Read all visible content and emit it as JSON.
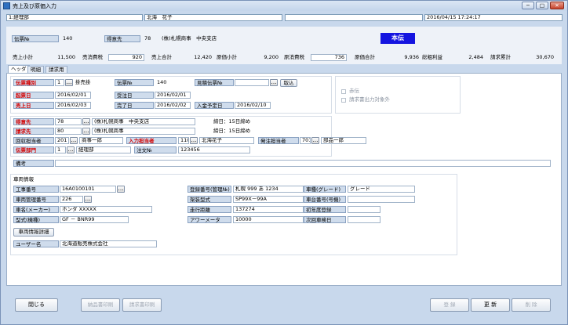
{
  "window": {
    "title": "売上及び原価入力",
    "minimize": "─",
    "maximize": "□",
    "close": "✕"
  },
  "header": {
    "dept": "1:経理部",
    "user": "北海　花子",
    "extra": "",
    "datetime": "2016/04/15 17:24:17"
  },
  "summary": {
    "denpyo_label": "伝票№",
    "denpyo_value": "140",
    "tokuisaki_label": "得意先",
    "tokuisaki_code": "78",
    "tokuisaki_name": "(株)札幌商事　中央支店",
    "badge": "本伝",
    "uriage_shokei_label": "売上小計",
    "uriage_shokei_value": "11,500",
    "uri_shohizei_label": "売消費税",
    "uri_shohizei_value": "920",
    "uriage_gokei_label": "売上合計",
    "uriage_gokei_value": "12,420",
    "genka_shokei_label": "原価小計",
    "genka_shokei_value": "9,200",
    "gen_shohizei_label": "原消費税",
    "gen_shohizei_value": "736",
    "genka_gokei_label": "原価合計",
    "genka_gokei_value": "9,936",
    "soarari_label": "総粗利益",
    "soarari_value": "2,484",
    "seikyu_label": "請求累計",
    "seikyu_value": "30,670"
  },
  "tabs": [
    "ヘッダ",
    "明細",
    "請求用"
  ],
  "form": {
    "denpyo_shubetsu_label": "伝票種別",
    "denpyo_shubetsu_code": "1",
    "denpyo_shubetsu_name": "掛売掛",
    "denpyo_no_label": "伝票№",
    "denpyo_no_value": "140",
    "mitsumori_label": "見積伝票№",
    "mitsumori_value": "",
    "torikomi_button": "取込",
    "kian_bi_label": "起票日",
    "kian_bi_value": "2016/02/01",
    "juchu_bi_label": "受注日",
    "juchu_bi_value": "2016/02/01",
    "uriage_bi_label": "売上日",
    "uriage_bi_value": "2016/02/03",
    "kanryo_bi_label": "完了日",
    "kanryo_bi_value": "2016/02/02",
    "nyukin_label": "入金予定日",
    "nyukin_value": "2016/02/10",
    "akaden_label": "赤伝",
    "seikyusho_label": "請求書出力対象外",
    "tokuisaki_label": "得意先",
    "tokuisaki_code": "78",
    "tokuisaki_name": "(株)札幌商事　中央支店",
    "tokuisaki_shime": "締日：15日締め",
    "seikyusaki_label": "請求先",
    "seikyusaki_code": "80",
    "seikyusaki_name": "(株)札幌商事",
    "seikyusaki_shime": "締日：15日締め",
    "kaishu_label": "回収担当者",
    "kaishu_code": "201",
    "kaishu_name": "商事一郎",
    "nyuryoku_label": "入力担当者",
    "nyuryoku_code": "110",
    "nyuryoku_name": "北海花子",
    "hatchu_label": "発注担当者",
    "hatchu_code": "701",
    "hatchu_name": "部品一郎",
    "denpyo_bumon_label": "伝票部門",
    "denpyo_bumon_code": "1",
    "denpyo_bumon_name": "経理部",
    "chumon_label": "注文№",
    "chumon_value": "123456",
    "biko_label": "備考",
    "biko_value": ""
  },
  "sharyo": {
    "section_title": "車両情報",
    "koji_label": "工事番号",
    "koji_value": "16A0100101",
    "toroku_label": "登録番号(管理№)",
    "toroku_value": "札幌 999 あ 1234",
    "grade_label": "車種(グレード)",
    "grade_value": "グレード",
    "kanri_label": "車両管理番号",
    "kanri_value": "226",
    "kata_label": "架装型式",
    "kata_value": "SP99X－99A",
    "shadai_label": "車台番号(号機)",
    "shadai_value": "",
    "maker_label": "車名(メーカー)",
    "maker_value": "ホンダ XXXXX",
    "soko_label": "走行距離",
    "soko_value": "137274",
    "shonendo_label": "初年度登録",
    "shonendo_value": "",
    "keishiki_label": "型式(機種)",
    "keishiki_value": "GF － BNR99",
    "hour_label": "アワーメータ",
    "hour_value": "10000",
    "jikai_label": "次回車検日",
    "jikai_value": "",
    "shosai_button": "車両情報詳細",
    "user_label": "ユーザー名",
    "user_value": "北海道販売株式会社"
  },
  "footer": {
    "close": "閉じる",
    "nohin": "納品書印刷",
    "seikyu": "請求書印刷",
    "toroku": "登 録",
    "koshin": "更 新",
    "sakujo": "削 除"
  }
}
